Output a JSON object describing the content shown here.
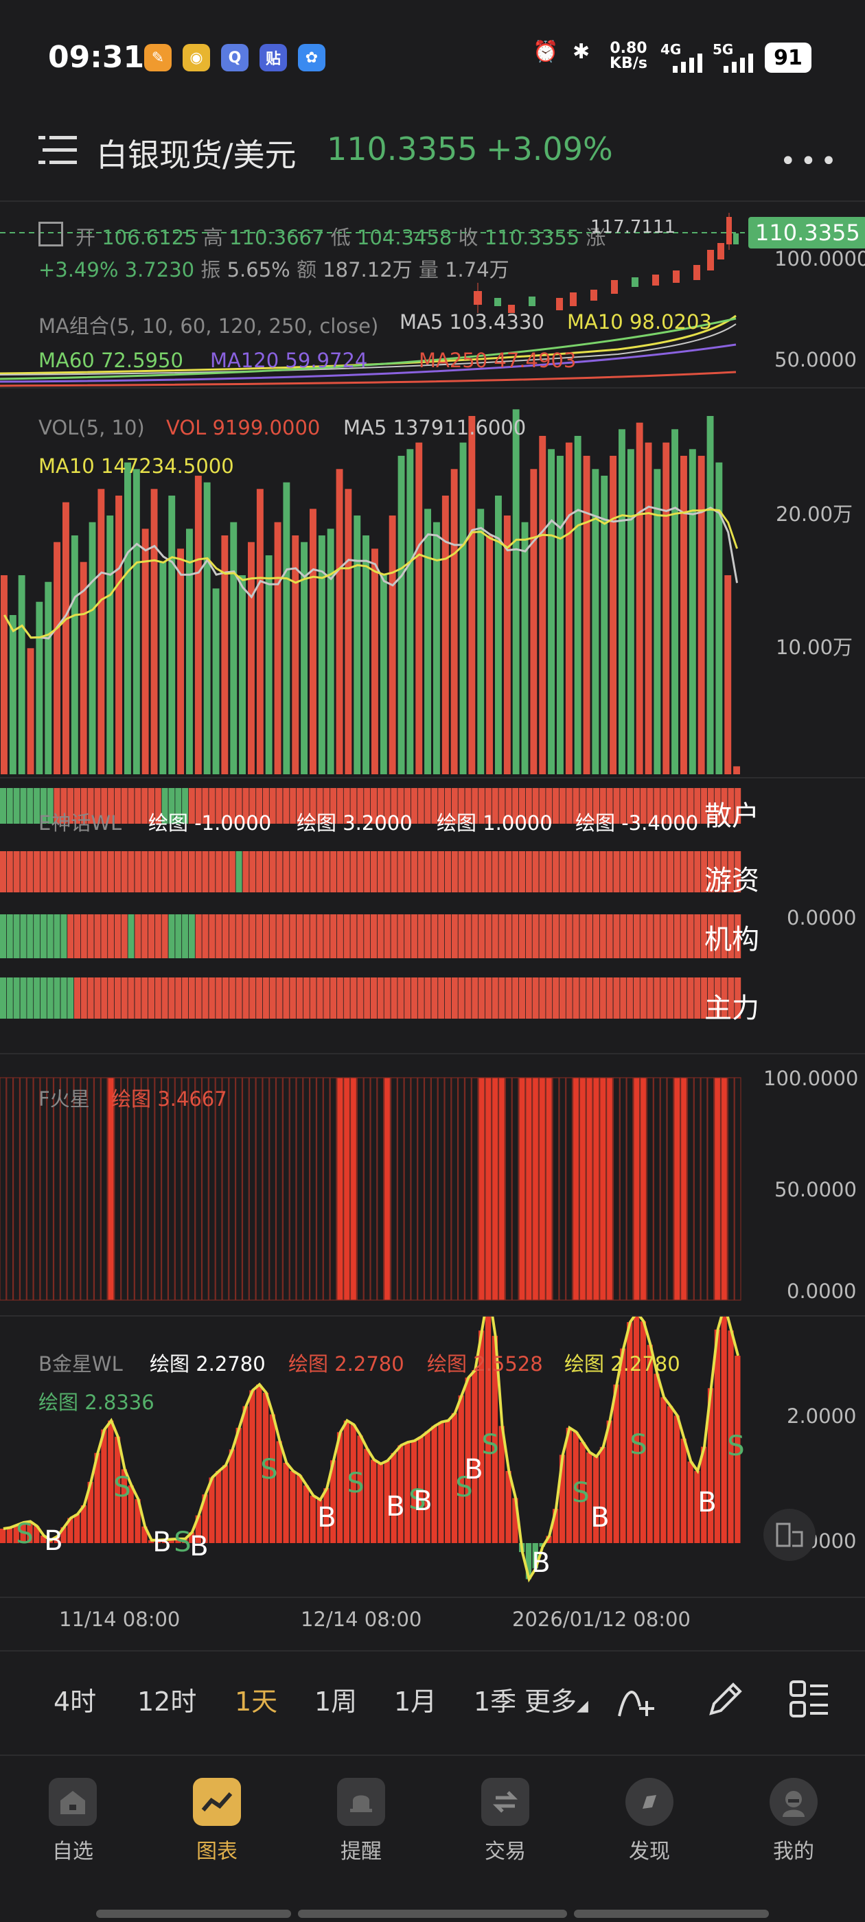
{
  "status": {
    "time": "09:31",
    "network_speed_value": "0.80",
    "network_speed_unit": "KB/s",
    "signal_1": "4G",
    "signal_2": "5G",
    "battery": "91"
  },
  "header": {
    "title": "白银现货/美元",
    "price": "110.3355",
    "change": "+3.09%"
  },
  "ohlc": {
    "open_label": "开",
    "open": "106.6125",
    "high_label": "高",
    "high": "110.3667",
    "low_label": "低",
    "low": "104.3458",
    "close_label": "收",
    "close": "110.3355",
    "chg_label": "涨",
    "row2": "+3.49% 3.7230",
    "amp_label": "振",
    "amp": "5.65%",
    "amount_label": "额",
    "amount": "187.12万",
    "vol_label": "量",
    "vol": "1.74万",
    "max_marker": "117.7111",
    "price_tag": "110.3355",
    "axis_top": "100.0000",
    "axis_mid": "50.0000"
  },
  "ma": {
    "title": "MA组合(5, 10, 60, 120, 250, close)",
    "ma5": "MA5 103.4330",
    "ma10": "MA10 98.0203",
    "ma60": "MA60 72.5950",
    "ma120": "MA120 59.9724",
    "ma250": "MA250 47.4903"
  },
  "vol_panel": {
    "title": "VOL(5, 10)",
    "vol": "VOL 9199.0000",
    "ma5": "MA5 137911.6000",
    "ma10": "MA10 147234.5000",
    "axis_top": "20.00万",
    "axis_mid": "10.00万"
  },
  "e_panel": {
    "title": "E神话WL",
    "v1": "绘图 -1.0000",
    "v2": "绘图 3.2000",
    "v3": "绘图 1.0000",
    "v4": "绘图 -3.4000",
    "rows": [
      "散户",
      "游资",
      "机构",
      "主力"
    ],
    "axis": "0.0000"
  },
  "f_panel": {
    "title": "F火星",
    "v1": "绘图 3.4667",
    "axis_top": "100.0000",
    "axis_mid": "50.0000",
    "axis_bot": "0.0000"
  },
  "b_panel": {
    "title": "B金星WL",
    "v1": "绘图 2.2780",
    "v2": "绘图 2.2780",
    "v3": "绘图 2.5528",
    "v4": "绘图 2.2780",
    "v5": "绘图 2.8336",
    "axis_top": "2.0000",
    "axis_bot": "0.0000",
    "buy_mark": "B",
    "sell_mark": "S"
  },
  "dates": [
    "11/14 08:00",
    "12/14 08:00",
    "2026/01/12 08:00"
  ],
  "timeframes": [
    "4时",
    "12时",
    "1天",
    "1周",
    "1月",
    "1季",
    "更多"
  ],
  "nav": [
    "自选",
    "图表",
    "提醒",
    "交易",
    "发现",
    "我的"
  ],
  "colors": {
    "up": "#e0513f",
    "down": "#54b06a",
    "accent": "#e2b14c",
    "ma5": "#c8c8c8",
    "ma10": "#e6e04a"
  },
  "chart_data": [
    {
      "type": "bar",
      "title": "VOL(5, 10)",
      "ylabel": "",
      "ylim": [
        0,
        270000
      ],
      "values": [
        150000,
        120000,
        150000,
        95000,
        130000,
        145000,
        175000,
        205000,
        180000,
        160000,
        190000,
        215000,
        195000,
        210000,
        235000,
        230000,
        185000,
        215000,
        160000,
        210000,
        170000,
        185000,
        225000,
        220000,
        140000,
        180000,
        190000,
        150000,
        175000,
        215000,
        165000,
        190000,
        220000,
        180000,
        175000,
        200000,
        180000,
        185000,
        230000,
        215000,
        195000,
        180000,
        170000,
        150000,
        195000,
        240000,
        245000,
        250000,
        200000,
        190000,
        210000,
        230000,
        250000,
        270000,
        200000,
        180000,
        210000,
        195000,
        275000,
        190000,
        230000,
        255000,
        245000,
        240000,
        250000,
        255000,
        240000,
        230000,
        225000,
        240000,
        260000,
        245000,
        265000,
        250000,
        230000,
        250000,
        260000,
        240000,
        245000,
        240000,
        270000,
        235000,
        150000,
        6000
      ]
    }
  ]
}
